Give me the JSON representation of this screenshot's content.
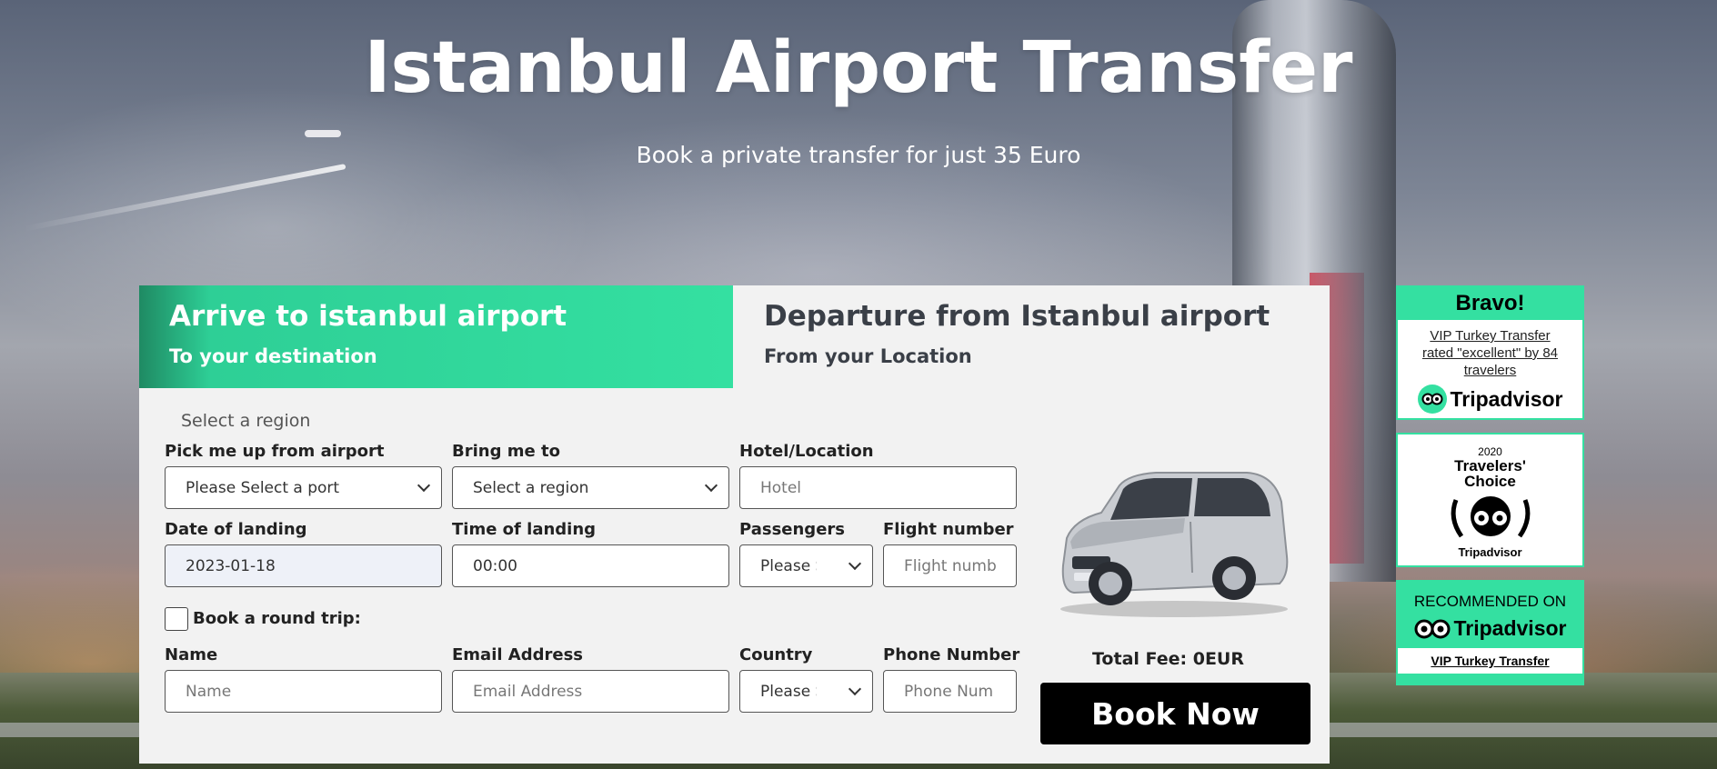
{
  "hero": {
    "title": "Istanbul Airport Transfer",
    "subtitle": "Book a private transfer for just 35 Euro"
  },
  "tabs": {
    "arrive": {
      "title": "Arrive to istanbul airport",
      "subtitle": "To your destination",
      "active": true
    },
    "depart": {
      "title": "Departure from Istanbul airport",
      "subtitle": "From your Location",
      "active": false
    }
  },
  "form": {
    "region_hint": "Select a region",
    "pickup": {
      "label": "Pick me up from airport",
      "value": "Please Select a port"
    },
    "bring": {
      "label": "Bring me to",
      "value": "Select a region"
    },
    "hotel": {
      "label": "Hotel/Location",
      "placeholder": "Hotel"
    },
    "date": {
      "label": "Date of landing",
      "value": "2023-01-18"
    },
    "time": {
      "label": "Time of landing",
      "value": "00:00"
    },
    "passengers": {
      "label": "Passengers",
      "value": "Please Se"
    },
    "flight": {
      "label": "Flight number",
      "placeholder": "Flight numb"
    },
    "round_trip": {
      "label": "Book a round trip:",
      "checked": false
    },
    "name": {
      "label": "Name",
      "placeholder": "Name"
    },
    "email": {
      "label": "Email Address",
      "placeholder": "Email Address"
    },
    "country": {
      "label": "Country",
      "value": "Please Se"
    },
    "phone": {
      "label": "Phone Number",
      "placeholder": "Phone Num"
    }
  },
  "summary": {
    "fee_label": "Total Fee:",
    "fee_value": "0EUR",
    "book_label": "Book Now",
    "vehicle_icon": "van-icon"
  },
  "badges": {
    "bravo": {
      "heading": "Bravo!",
      "text": "VIP Turkey Transfer rated \"excellent\" by 84 travelers",
      "brand": "Tripadvisor"
    },
    "travelers_choice": {
      "year": "2020",
      "line1": "Travelers'",
      "line2": "Choice",
      "brand": "Tripadvisor"
    },
    "recommended": {
      "heading": "RECOMMENDED ON",
      "brand": "Tripadvisor",
      "link": "VIP Turkey Transfer"
    }
  },
  "colors": {
    "accent": "#34e0a1",
    "button": "#000000",
    "panel": "#f2f2f2"
  }
}
